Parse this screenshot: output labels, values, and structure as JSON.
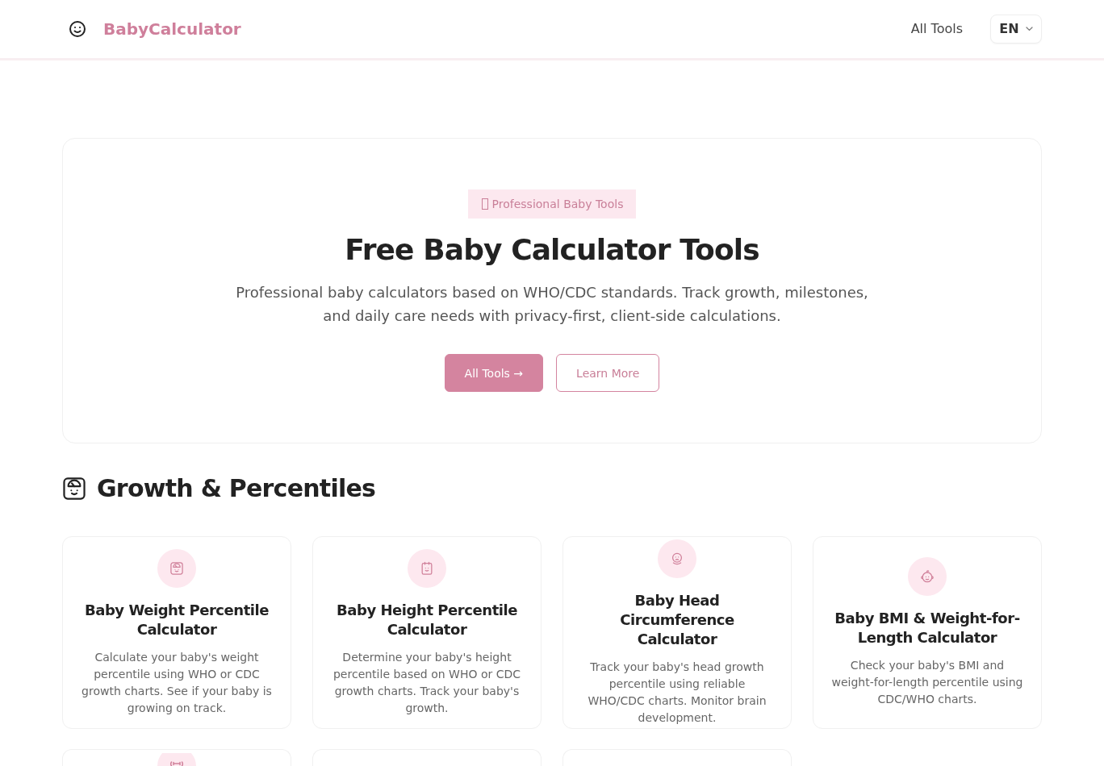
{
  "header": {
    "logo": "BabyCalculator",
    "nav_links": [
      "All Tools"
    ],
    "language": "EN"
  },
  "hero": {
    "badge": "Professional Baby Tools",
    "title": "Free Baby Calculator Tools",
    "description": "Professional baby calculators based on WHO/CDC standards. Track growth, milestones, and daily care needs with privacy-first, client-side calculations.",
    "buttons": [
      {
        "label": "All Tools →",
        "kind": "primary"
      },
      {
        "label": "Learn More",
        "kind": "outline"
      }
    ]
  },
  "sections": [
    {
      "title": "Growth & Percentiles",
      "cards": [
        {
          "kind": "full",
          "title": "Baby Weight Percentile Calculator",
          "description": "Calculate your baby's weight percentile using WHO or CDC growth charts. See if your baby is growing on track."
        },
        {
          "kind": "full",
          "title": "Baby Height Percentile Calculator",
          "description": "Determine your baby's height percentile based on WHO or CDC growth charts. Track your baby's growth."
        },
        {
          "kind": "full",
          "title": "Baby Head Circumference Calculator",
          "description": "Track your baby's head growth percentile using reliable WHO/CDC charts. Monitor brain development."
        },
        {
          "kind": "full",
          "title": "Baby BMI & Weight-for-Length Calculator",
          "description": "Check your baby's BMI and weight-for-length percentile using CDC/WHO charts."
        },
        {
          "kind": "clipped",
          "icon_visible": true
        },
        {
          "kind": "clipped",
          "icon_visible": false
        },
        {
          "kind": "clipped",
          "icon_visible": false
        }
      ]
    }
  ]
}
